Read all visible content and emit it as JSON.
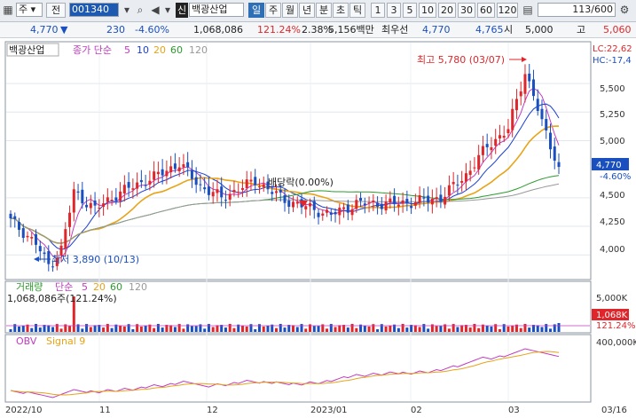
{
  "toolbar": {
    "market": "주",
    "market_btn": "전",
    "code": "001340",
    "name_tag": "신",
    "stock_name": "백광산업",
    "periods": [
      "일",
      "주",
      "월",
      "년",
      "분",
      "초",
      "틱"
    ],
    "active_period": "일",
    "minutes": [
      "1",
      "3",
      "5",
      "10",
      "20",
      "30",
      "60",
      "120"
    ],
    "count": "113/600"
  },
  "info": {
    "price": "4,770",
    "arrow": "▼",
    "change": "230",
    "change_pct": "-4.60%",
    "volume": "1,068,086",
    "vol_ratio": "121.24%",
    "turnover": "2.38%",
    "amount": "5,156백만",
    "best_label": "최우선",
    "best_ask": "4,770",
    "best_bid": "4,765",
    "open_label": "시",
    "open": "5,000",
    "high_label": "고",
    "high": "5,060"
  },
  "price_panel": {
    "title": "백광산업",
    "ma_label": "종가 단순",
    "ma_periods": [
      "5",
      "10",
      "20",
      "60",
      "120"
    ],
    "ma_colors": [
      "#c03cc0",
      "#1a3fcf",
      "#e8a317",
      "#2d9a2d",
      "#999999"
    ],
    "lc": "LC:22,62",
    "hc": "HC:-17,4",
    "yticks": [
      "5,500",
      "5,250",
      "5,000",
      "4,770",
      "4,500",
      "4,250",
      "4,000"
    ],
    "current_price": "4,770",
    "current_pct": "-4.60%",
    "max_label": "최고 5,780 (03/07)",
    "min_label": "최저 3,890 (10/13)",
    "dividend_label": "배당락(0.00%)"
  },
  "volume_panel": {
    "title": "거래량",
    "ma_label": "단순",
    "ma_periods": [
      "5",
      "20",
      "60",
      "120"
    ],
    "value": "1,068,086주(121.24%)",
    "ytick": "5,000K",
    "current": "1,068K",
    "current_pct": "121.24%"
  },
  "obv_panel": {
    "title": "OBV",
    "signal": "Signal 9",
    "ytick": "400,000K"
  },
  "xaxis": [
    "2022/10",
    "11",
    "12",
    "2023/01",
    "02",
    "03",
    "03/16"
  ],
  "colors": {
    "up": "#e0262a",
    "down": "#1a4fbf",
    "accent": "#2f6fb6"
  },
  "chart_data": {
    "type": "candlestick",
    "title": "백광산업",
    "ylim": [
      3800,
      5850
    ],
    "max": {
      "value": 5780,
      "date": "03/07"
    },
    "min": {
      "value": 3890,
      "date": "10/13"
    },
    "last_close": 4770
  }
}
